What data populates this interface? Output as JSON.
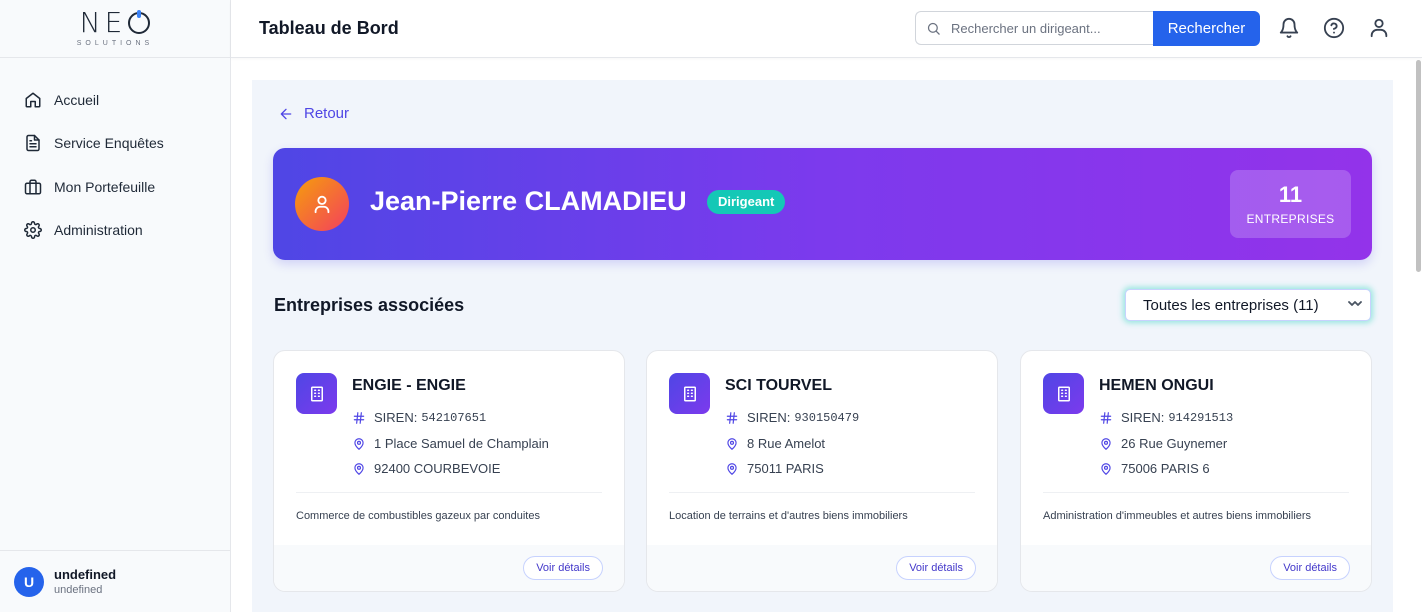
{
  "brand": {
    "logo_main": "NE",
    "logo_sub": "SOLUTIONS"
  },
  "sidebar": {
    "items": [
      {
        "label": "Accueil",
        "icon": "home-icon"
      },
      {
        "label": "Service Enquêtes",
        "icon": "document-icon"
      },
      {
        "label": "Mon Portefeuille",
        "icon": "briefcase-icon"
      },
      {
        "label": "Administration",
        "icon": "gear-icon"
      }
    ],
    "user": {
      "initial": "U",
      "name": "undefined",
      "sub": "undefined"
    }
  },
  "header": {
    "title": "Tableau de Bord",
    "search_placeholder": "Rechercher un dirigeant...",
    "search_button": "Rechercher"
  },
  "main": {
    "back_label": "Retour",
    "person": {
      "name": "Jean-Pierre CLAMADIEU",
      "role": "Dirigeant",
      "count": "11",
      "count_label": "ENTREPRISES"
    },
    "section_title": "Entreprises associées",
    "filter_value": "Toutes les entreprises (11)",
    "companies": [
      {
        "name": "ENGIE - ENGIE",
        "siren_label": "SIREN:",
        "siren": "542107651",
        "address": "1 Place Samuel de Champlain",
        "city": "92400 COURBEVOIE",
        "activity": "Commerce de combustibles gazeux par conduites",
        "button": "Voir détails"
      },
      {
        "name": "SCI TOURVEL",
        "siren_label": "SIREN:",
        "siren": "930150479",
        "address": "8 Rue Amelot",
        "city": "75011 PARIS",
        "activity": "Location de terrains et d'autres biens immobiliers",
        "button": "Voir détails"
      },
      {
        "name": "HEMEN ONGUI",
        "siren_label": "SIREN:",
        "siren": "914291513",
        "address": "26 Rue Guynemer",
        "city": "75006 PARIS 6",
        "activity": "Administration d'immeubles et autres biens immobiliers",
        "button": "Voir détails"
      }
    ]
  },
  "colors": {
    "accent": "#2563eb",
    "indigo": "#4f46e5",
    "purple": "#9333ea",
    "teal_badge": "#14c8b6"
  }
}
